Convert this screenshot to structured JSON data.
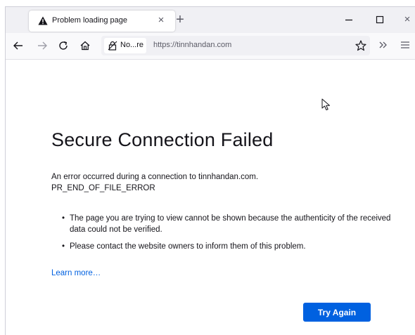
{
  "tab": {
    "title": "Problem loading page",
    "icon": "warning-icon",
    "close_label": "×",
    "new_tab_label": "+"
  },
  "window_controls": {
    "minimize_label": "–",
    "close_label": "×"
  },
  "navbar": {
    "identity_label": "No...re",
    "url": "https://tinnhandan.com",
    "icons": [
      "back-icon",
      "forward-icon",
      "reload-icon",
      "home-icon",
      "lock-icon",
      "star-icon",
      "overflow-icon",
      "menu-icon"
    ]
  },
  "error": {
    "title": "Secure Connection Failed",
    "description_line1": "An error occurred during a connection to tinnhandan.com.",
    "description_line2": "PR_END_OF_FILE_ERROR",
    "bullets": [
      "The page you are trying to view cannot be shown because the authenticity of the received data could not be verified.",
      "Please contact the website owners to inform them of this problem."
    ],
    "learn_more": "Learn more…",
    "try_again": "Try Again"
  },
  "colors": {
    "accent": "#0061e0",
    "tabbar_bg": "#f0f0f4",
    "text": "#15141a"
  }
}
